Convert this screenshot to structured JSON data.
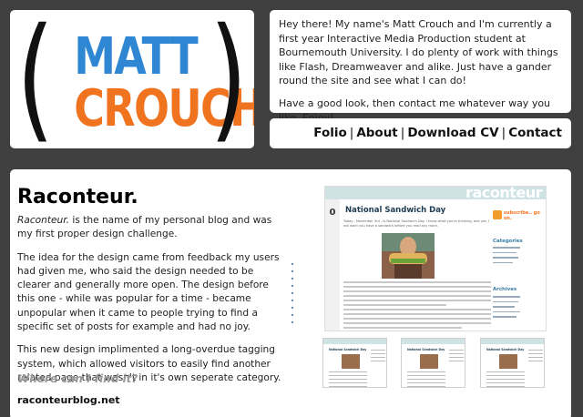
{
  "logo": {
    "paren_left": "(",
    "paren_right": ")",
    "first_name": "MATT",
    "last_name": "CROUCH",
    "colors": {
      "first_name": "#2f86d3",
      "last_name": "#f07320",
      "parens": "#111111"
    }
  },
  "intro": {
    "paragraph_1": "Hey there! My name's Matt Crouch and I'm currently a first year Interactive Media Production student at Bournemouth University. I do plenty of work with things like Flash, Dreamweaver and alike. Just have a gander round the site and see what I can do!",
    "paragraph_2": "Have a good look, then contact me whatever way you like. Enjoy!"
  },
  "nav": {
    "separator": "|",
    "items": [
      {
        "label": "Folio"
      },
      {
        "label": "About"
      },
      {
        "label": "Download CV"
      },
      {
        "label": "Contact"
      }
    ]
  },
  "project": {
    "title": "Raconteur.",
    "name_italic": "Raconteur.",
    "paragraph_1_rest": " is the name of my personal blog and was my first proper design challenge.",
    "paragraph_2": "The idea for the design came from feedback my users had given me, who said the design needed to be clearer and generally more open. The design before this one - while was popular for a time - became unpopular when it came to people trying to find a specific set of posts for example and had no joy.",
    "paragraph_3": "This new design implimented a long-overdue tagging system, which allowed visitors to easily find another related page that wasn't in it's own seperate category.",
    "where_heading": "Where can I find it?",
    "link": "raconteurblog.net"
  },
  "screenshot": {
    "brand": "raconteur",
    "comment_count": "0",
    "post_title": "National Sandwich Day",
    "post_meta": "Today - November 3rd - is National Sandwich Day. I know what you're thinking, and yes, I will want you have a sandwich before you read any more.",
    "subscribe": "subscribe.. go on.",
    "sidebar_headings": [
      "Categories",
      "Archives"
    ],
    "thumbnail_title": "National Sandwich Day"
  }
}
